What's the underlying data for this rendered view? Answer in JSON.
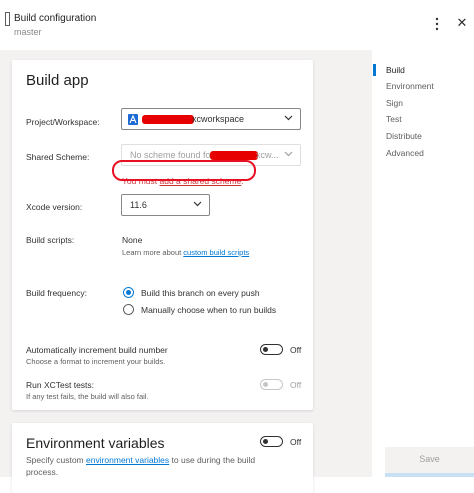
{
  "header": {
    "title": "Build configuration",
    "subtitle": "master",
    "more_icon": "more-vertical-icon",
    "close_icon": "close-icon",
    "close_glyph": "✕"
  },
  "build_app": {
    "title": "Build app",
    "project": {
      "label": "Project/Workspace:",
      "value_suffix": "xcworkspace"
    },
    "scheme": {
      "label": "Shared Scheme:",
      "placeholder_prefix": "No scheme found fo",
      "placeholder_suffix": "xcw...",
      "error_prefix": "You must ",
      "error_link": "add a shared scheme",
      "error_suffix": "."
    },
    "xcode": {
      "label": "Xcode version:",
      "value": "11.6"
    },
    "scripts": {
      "label": "Build scripts:",
      "value": "None",
      "hint_prefix": "Learn more about ",
      "hint_link": "custom build scripts"
    },
    "frequency": {
      "label": "Build frequency:",
      "options": [
        "Build this branch on every push",
        "Manually choose when to run builds"
      ],
      "selected": 0
    },
    "auto_increment": {
      "label": "Automatically increment build number",
      "hint": "Choose a format to increment your builds.",
      "state": "Off"
    },
    "xctest": {
      "label": "Run XCTest tests:",
      "hint": "If any test fails, the build will also fail.",
      "state": "Off"
    }
  },
  "env": {
    "title": "Environment variables",
    "state": "Off",
    "desc_prefix": "Specify custom ",
    "desc_link": "environment variables",
    "desc_suffix": " to use during the build",
    "desc_line2": "process."
  },
  "nav": {
    "items": [
      "Build",
      "Environment",
      "Sign",
      "Test",
      "Distribute",
      "Advanced"
    ],
    "active": 0
  },
  "footer": {
    "save_label": "Save"
  },
  "colors": {
    "accent": "#0078d4",
    "error": "#d13438",
    "annotation": "#e81123",
    "redaction": "#e60000"
  }
}
